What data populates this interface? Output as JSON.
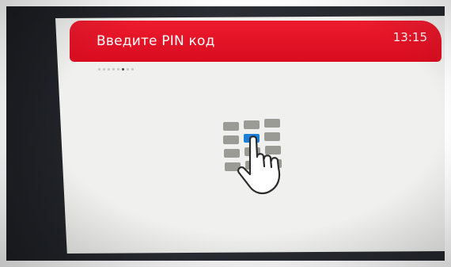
{
  "header": {
    "title": "Введите PIN код",
    "time": "13:15"
  },
  "progress": {
    "total_steps": 8,
    "current_step": 6
  },
  "illustration": {
    "icon": "pin-keypad-touch-icon"
  },
  "colors": {
    "header_red": "#e3122a",
    "screen_bg": "#f0f0ee",
    "key_gray": "#9b9b96",
    "key_active_blue": "#1e7fd8"
  }
}
